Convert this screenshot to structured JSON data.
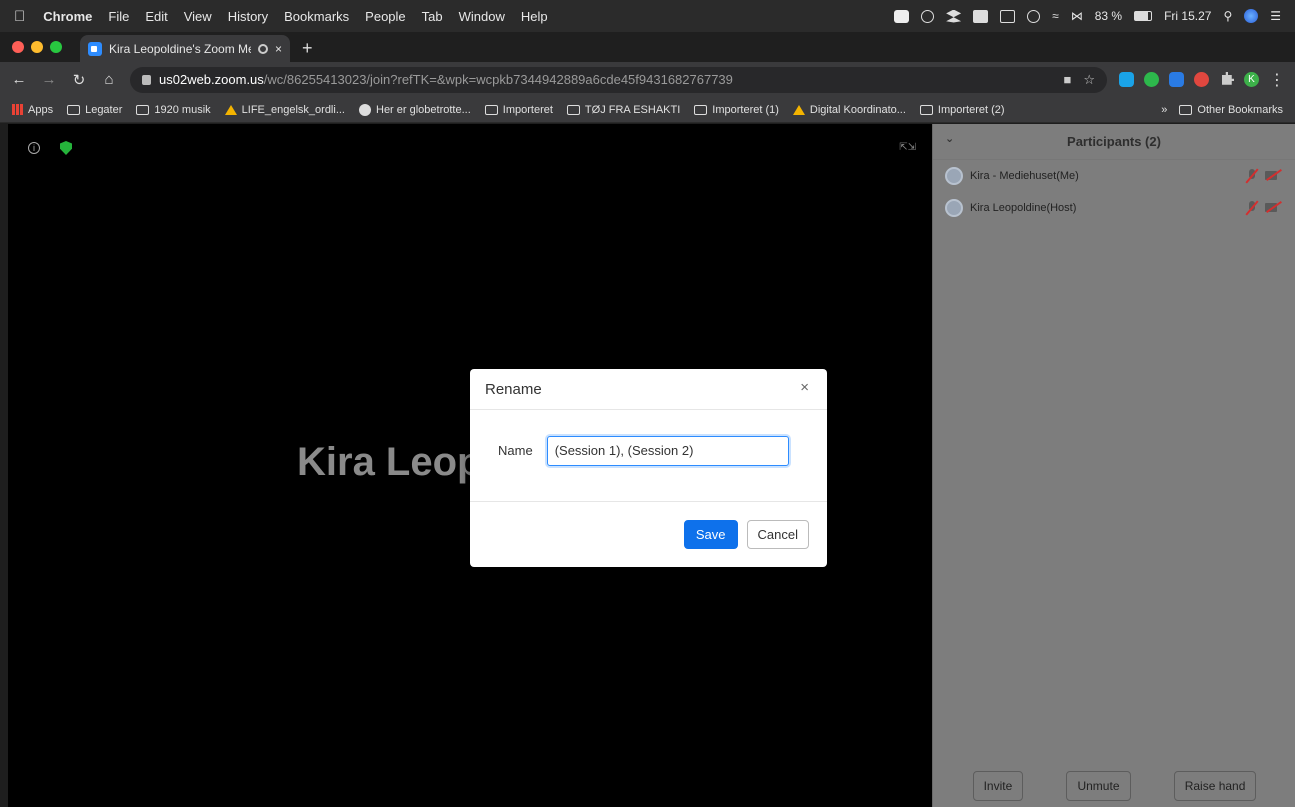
{
  "menubar": {
    "apple_icon": "apple-icon",
    "app": "Chrome",
    "items": [
      "File",
      "Edit",
      "View",
      "History",
      "Bookmarks",
      "People",
      "Tab",
      "Window",
      "Help"
    ],
    "battery": "83 %",
    "clock": "Fri 15.27"
  },
  "tab": {
    "title": "Kira Leopoldine's Zoom Me",
    "new_tab": "+",
    "close": "×"
  },
  "address": {
    "host": "us02web.zoom.us",
    "path": "/wc/86255413023/join?refTK=&wpk=wcpkb7344942889a6cde45f9431682767739",
    "profile_initial": "K"
  },
  "bookmarks": {
    "items": [
      {
        "label": "Apps",
        "icon": "apps-grid-icon"
      },
      {
        "label": "Legater",
        "icon": "folder-icon"
      },
      {
        "label": "1920 musik",
        "icon": "folder-icon"
      },
      {
        "label": "LIFE_engelsk_ordli...",
        "icon": "google-drive-icon"
      },
      {
        "label": "Her er globetrotte...",
        "icon": "site-icon"
      },
      {
        "label": "Importeret",
        "icon": "folder-icon"
      },
      {
        "label": "TØJ FRA ESHAKTI",
        "icon": "folder-icon"
      },
      {
        "label": "Importeret (1)",
        "icon": "folder-icon"
      },
      {
        "label": "Digital Koordinato...",
        "icon": "google-drive-icon"
      },
      {
        "label": "Importeret (2)",
        "icon": "folder-icon"
      }
    ],
    "overflow": "»",
    "other": "Other Bookmarks"
  },
  "video": {
    "speaker_name": "Kira Leopoldine"
  },
  "participants": {
    "title": "Participants (2)",
    "list": [
      {
        "name": "Kira - Mediehuset(Me)"
      },
      {
        "name": "Kira Leopoldine(Host)"
      }
    ],
    "buttons": {
      "invite": "Invite",
      "unmute": "Unmute",
      "raise_hand": "Raise hand"
    }
  },
  "rename_dialog": {
    "title": "Rename",
    "close": "×",
    "name_label": "Name",
    "name_value": "(Session 1), (Session 2)",
    "save": "Save",
    "cancel": "Cancel"
  }
}
